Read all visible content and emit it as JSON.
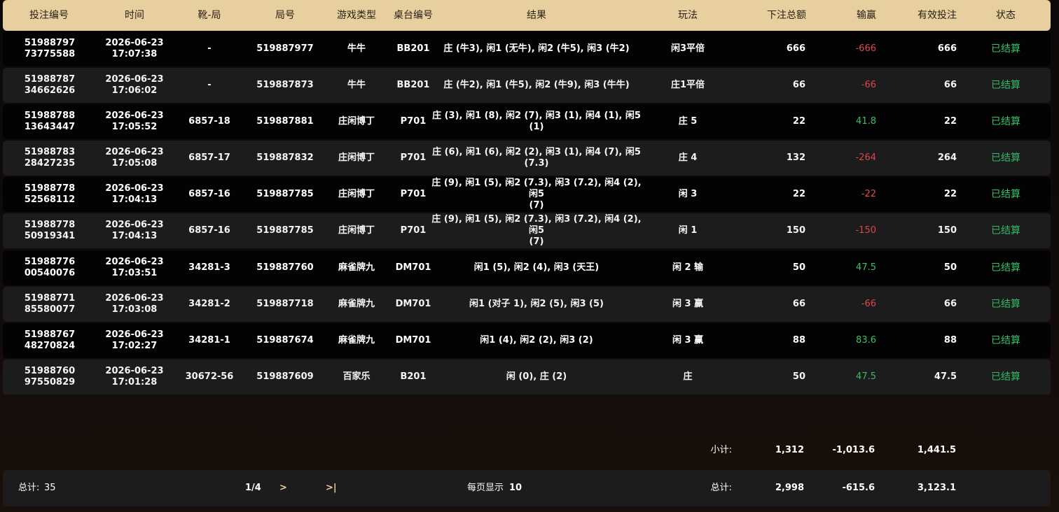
{
  "header": {
    "bet_id": "投注编号",
    "time": "时间",
    "shoe_round": "靴-局",
    "round_no": "局号",
    "game_type": "游戏类型",
    "table_no": "桌台编号",
    "result": "结果",
    "play": "玩法",
    "total_bet": "下注总额",
    "win_loss": "输赢",
    "valid_bet": "有效投注",
    "status": "状态"
  },
  "rows": [
    {
      "id1": "51988797",
      "id2": "73775588",
      "date": "2026-06-23",
      "time": "17:07:38",
      "shoe": "-",
      "round": "519887977",
      "game": "牛牛",
      "table": "BB201",
      "result1": "庄 (牛3), 闲1 (无牛), 闲2 (牛5), 闲3 (牛2)",
      "result2": "",
      "play": "闲3平倍",
      "bet": "666",
      "winloss": "-666",
      "wl_sign": "neg",
      "valid": "666",
      "status": "已结算"
    },
    {
      "id1": "51988787",
      "id2": "34662626",
      "date": "2026-06-23",
      "time": "17:06:02",
      "shoe": "-",
      "round": "519887873",
      "game": "牛牛",
      "table": "BB201",
      "result1": "庄 (牛2), 闲1 (牛5), 闲2 (牛9), 闲3 (牛牛)",
      "result2": "",
      "play": "庄1平倍",
      "bet": "66",
      "winloss": "-66",
      "wl_sign": "neg",
      "valid": "66",
      "status": "已结算"
    },
    {
      "id1": "51988788",
      "id2": "13643447",
      "date": "2026-06-23",
      "time": "17:05:52",
      "shoe": "6857-18",
      "round": "519887881",
      "game": "庄闲博丁",
      "table": "P701",
      "result1": "庄 (3), 闲1 (8), 闲2 (7), 闲3 (1), 闲4 (1), 闲5 (1)",
      "result2": "",
      "play": "庄 5",
      "bet": "22",
      "winloss": "41.8",
      "wl_sign": "pos",
      "valid": "22",
      "status": "已结算"
    },
    {
      "id1": "51988783",
      "id2": "28427235",
      "date": "2026-06-23",
      "time": "17:05:08",
      "shoe": "6857-17",
      "round": "519887832",
      "game": "庄闲博丁",
      "table": "P701",
      "result1": "庄 (6), 闲1 (6), 闲2 (2), 闲3 (1), 闲4 (7), 闲5 (7.3)",
      "result2": "",
      "play": "庄 4",
      "bet": "132",
      "winloss": "-264",
      "wl_sign": "neg",
      "valid": "264",
      "status": "已结算"
    },
    {
      "id1": "51988778",
      "id2": "52568112",
      "date": "2026-06-23",
      "time": "17:04:13",
      "shoe": "6857-16",
      "round": "519887785",
      "game": "庄闲博丁",
      "table": "P701",
      "result1": "庄 (9), 闲1 (5), 闲2 (7.3), 闲3 (7.2), 闲4 (2), 闲5",
      "result2": "(7)",
      "play": "闲 3",
      "bet": "22",
      "winloss": "-22",
      "wl_sign": "neg",
      "valid": "22",
      "status": "已结算"
    },
    {
      "id1": "51988778",
      "id2": "50919341",
      "date": "2026-06-23",
      "time": "17:04:13",
      "shoe": "6857-16",
      "round": "519887785",
      "game": "庄闲博丁",
      "table": "P701",
      "result1": "庄 (9), 闲1 (5), 闲2 (7.3), 闲3 (7.2), 闲4 (2), 闲5",
      "result2": "(7)",
      "play": "闲 1",
      "bet": "150",
      "winloss": "-150",
      "wl_sign": "neg",
      "valid": "150",
      "status": "已结算"
    },
    {
      "id1": "51988776",
      "id2": "00540076",
      "date": "2026-06-23",
      "time": "17:03:51",
      "shoe": "34281-3",
      "round": "519887760",
      "game": "麻雀牌九",
      "table": "DM701",
      "result1": "闲1 (5), 闲2 (4), 闲3 (天王)",
      "result2": "",
      "play": "闲 2 输",
      "bet": "50",
      "winloss": "47.5",
      "wl_sign": "pos",
      "valid": "50",
      "status": "已结算"
    },
    {
      "id1": "51988771",
      "id2": "85580077",
      "date": "2026-06-23",
      "time": "17:03:08",
      "shoe": "34281-2",
      "round": "519887718",
      "game": "麻雀牌九",
      "table": "DM701",
      "result1": "闲1 (对子 1), 闲2 (5), 闲3 (5)",
      "result2": "",
      "play": "闲 3 赢",
      "bet": "66",
      "winloss": "-66",
      "wl_sign": "neg",
      "valid": "66",
      "status": "已结算"
    },
    {
      "id1": "51988767",
      "id2": "48270824",
      "date": "2026-06-23",
      "time": "17:02:27",
      "shoe": "34281-1",
      "round": "519887674",
      "game": "麻雀牌九",
      "table": "DM701",
      "result1": "闲1 (4), 闲2 (2), 闲3 (2)",
      "result2": "",
      "play": "闲 3 赢",
      "bet": "88",
      "winloss": "83.6",
      "wl_sign": "pos",
      "valid": "88",
      "status": "已结算"
    },
    {
      "id1": "51988760",
      "id2": "97550829",
      "date": "2026-06-23",
      "time": "17:01:28",
      "shoe": "30672-56",
      "round": "519887609",
      "game": "百家乐",
      "table": "B201",
      "result1": "闲 (0), 庄 (2)",
      "result2": "",
      "play": "庄",
      "bet": "50",
      "winloss": "47.5",
      "wl_sign": "pos",
      "valid": "47.5",
      "status": "已结算"
    }
  ],
  "subtotal": {
    "label": "小计:",
    "bet": "1,312",
    "winloss": "-1,013.6",
    "valid": "1,441.5"
  },
  "footer": {
    "count_label": "总计:",
    "count": "35",
    "page": "1/4",
    "next": ">",
    "last": ">|",
    "per_page_label": "每页显示",
    "per_page": "10",
    "total_label": "总计:",
    "total_bet": "2,998",
    "total_winloss": "-615.6",
    "total_valid": "3,123.1"
  },
  "colors": {
    "header_bg": "#e7cf9f",
    "negative": "#e5484d",
    "positive": "#3fbf68",
    "status": "#35c26a"
  }
}
